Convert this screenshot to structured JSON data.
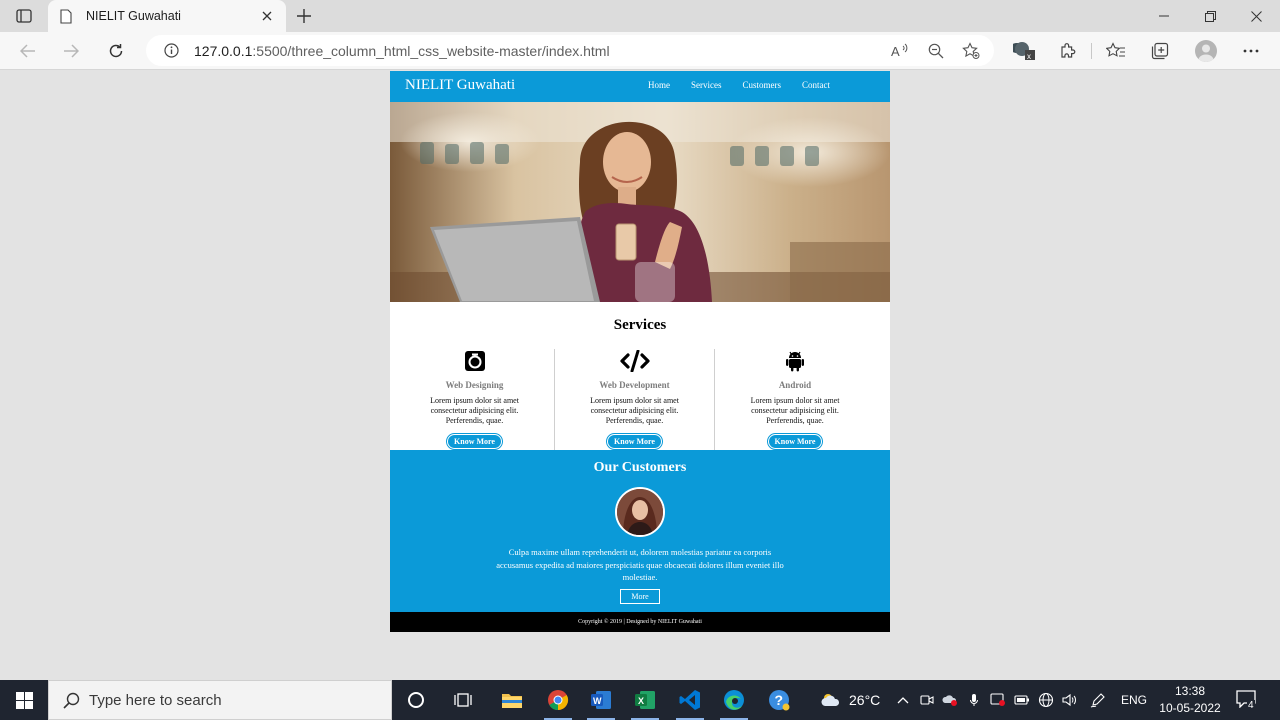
{
  "browser": {
    "tab_title": "NIELIT Guwahati",
    "url_host": "127.0.0.1",
    "url_rest": ":5500/three_column_html_css_website-master/index.html"
  },
  "site": {
    "logo": "NIELIT Guwahati",
    "nav": [
      "Home",
      "Services",
      "Customers",
      "Contact"
    ],
    "services_title": "Services",
    "services": [
      {
        "name": "Web Designing",
        "desc": "Lorem ipsum dolor sit amet consectetur adipisicing elit. Perferendis, quae.",
        "button": "Know More",
        "icon": "camera-icon"
      },
      {
        "name": "Web Development",
        "desc": "Lorem ipsum dolor sit amet consectetur adipisicing elit. Perferendis, quae.",
        "button": "Know More",
        "icon": "code-icon"
      },
      {
        "name": "Android",
        "desc": "Lorem ipsum dolor sit amet consectetur adipisicing elit. Perferendis, quae.",
        "button": "Know More",
        "icon": "android-icon"
      }
    ],
    "customers_title": "Our Customers",
    "customer_text": "Culpa maxime ullam reprehenderit ut, dolorem molestias pariatur ea corporis accusamus expedita ad maiores perspiciatis quae obcaecati dolores illum eveniet illo molestiae.",
    "customer_button": "More",
    "footer": "Copyright © 2019 | Designed by NIELIT Guwahati"
  },
  "taskbar": {
    "search_placeholder": "Type here to search",
    "weather": "26°C",
    "language": "ENG",
    "time": "13:38",
    "date": "10-05-2022",
    "notification_count": "4"
  },
  "colors": {
    "site_accent": "#0b9ad8",
    "footer_bg": "#000000",
    "taskbar_bg": "#1f2530"
  }
}
